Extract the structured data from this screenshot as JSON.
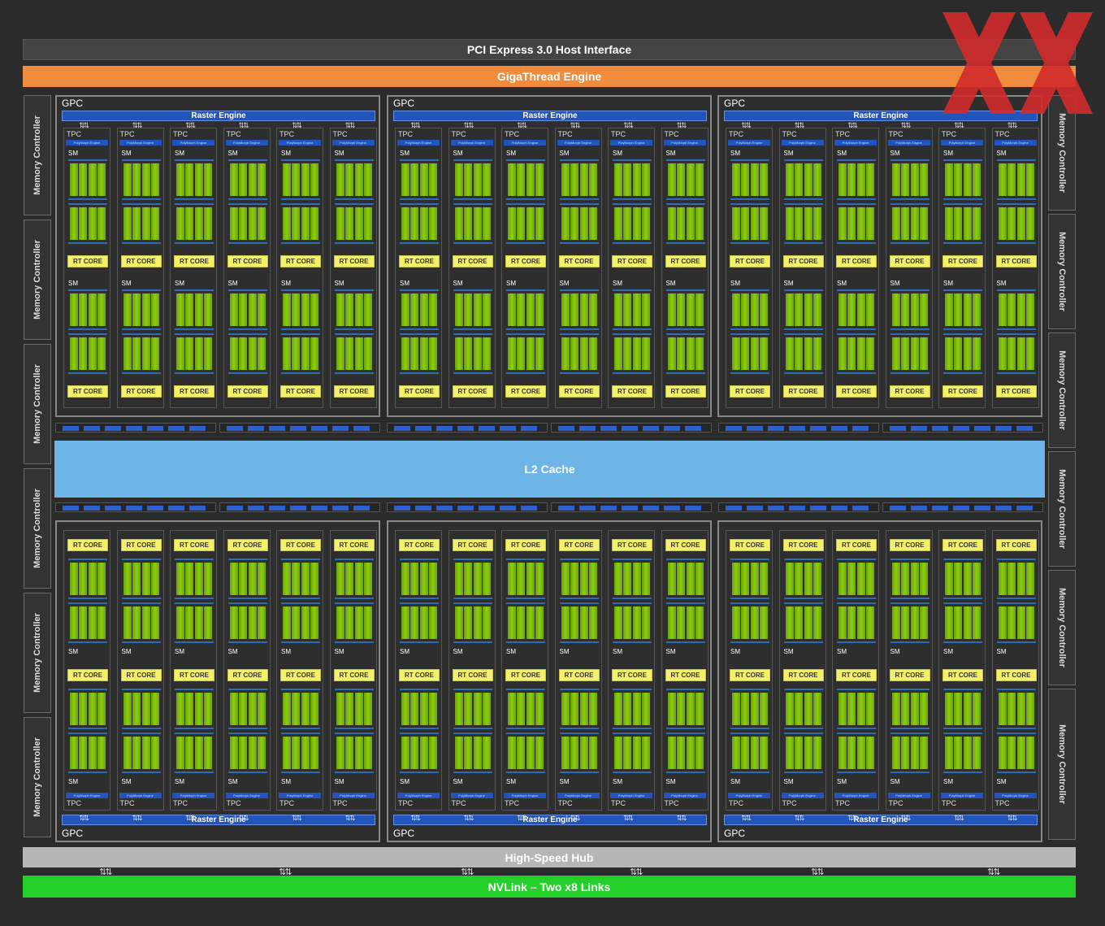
{
  "pci_label": "PCI Express 3.0 Host Interface",
  "giga_label": "GigaThread Engine",
  "l2_label": "L2 Cache",
  "hub_label": "High-Speed Hub",
  "nvlink_label": "NVLink – Two x8 Links",
  "memory_controller_label": "Memory Controller",
  "gpc_label": "GPC",
  "raster_label": "Raster Engine",
  "tpc_label": "TPC",
  "polymorph_label": "PolyMorph Engine",
  "sm_label": "SM",
  "rt_label": "RT CORE",
  "arrow_glyph": "⇅⇅",
  "colors": {
    "background": "#2b2b2b",
    "giga": "#f08c3c",
    "l2": "#6cb5e6",
    "nvlink": "#23d12a",
    "hub": "#b6b6b6",
    "raster": "#2255bb",
    "rt_core": "#f3f06a",
    "cuda_core": "#8ad00c",
    "logo": "#d22b2b"
  },
  "layout_counts": {
    "gpcs_per_row": 3,
    "gpc_rows": 2,
    "tpcs_per_gpc": 6,
    "sms_per_tpc": 2,
    "memory_controllers_per_side": 6
  }
}
